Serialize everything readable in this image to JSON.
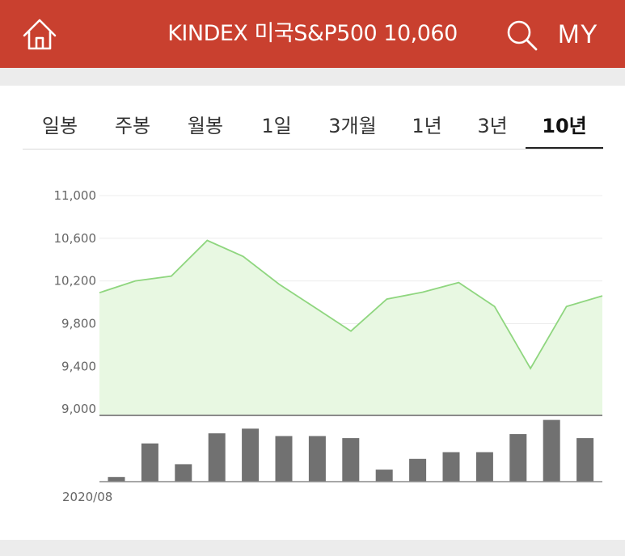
{
  "header": {
    "title": "KINDEX 미국S&P500 10,060",
    "right_label": "MY",
    "home_icon": "home-icon",
    "search_icon": "search-icon",
    "background_color": "#c9402f"
  },
  "tabs": [
    {
      "label": "일봉",
      "active": false
    },
    {
      "label": "주봉",
      "active": false
    },
    {
      "label": "월봉",
      "active": false
    },
    {
      "label": "1일",
      "active": false
    },
    {
      "label": "3개월",
      "active": false
    },
    {
      "label": "1년",
      "active": false
    },
    {
      "label": "3년",
      "active": false
    },
    {
      "label": "10년",
      "active": true
    }
  ],
  "chart_data": [
    {
      "type": "area",
      "y_ticks": [
        "11,000",
        "10,600",
        "10,200",
        "9,800",
        "9,400",
        "9,000"
      ],
      "y_tick_values": [
        11000,
        10600,
        10200,
        9800,
        9400,
        9000
      ],
      "ylim": [
        8940,
        11000
      ],
      "values": [
        10090,
        10200,
        10245,
        10580,
        10430,
        10170,
        9950,
        9730,
        10030,
        10095,
        10185,
        9960,
        9380,
        9960,
        10060
      ],
      "grid": true,
      "line_color": "#8fd67f",
      "fill_color": "#e8f8e2"
    },
    {
      "type": "bar",
      "x_label": "2020/08",
      "values": [
        0.07,
        0.57,
        0.26,
        0.72,
        0.79,
        0.68,
        0.68,
        0.65,
        0.18,
        0.34,
        0.44,
        0.44,
        0.71,
        0.92,
        0.65
      ],
      "bar_color": "#717171"
    }
  ]
}
